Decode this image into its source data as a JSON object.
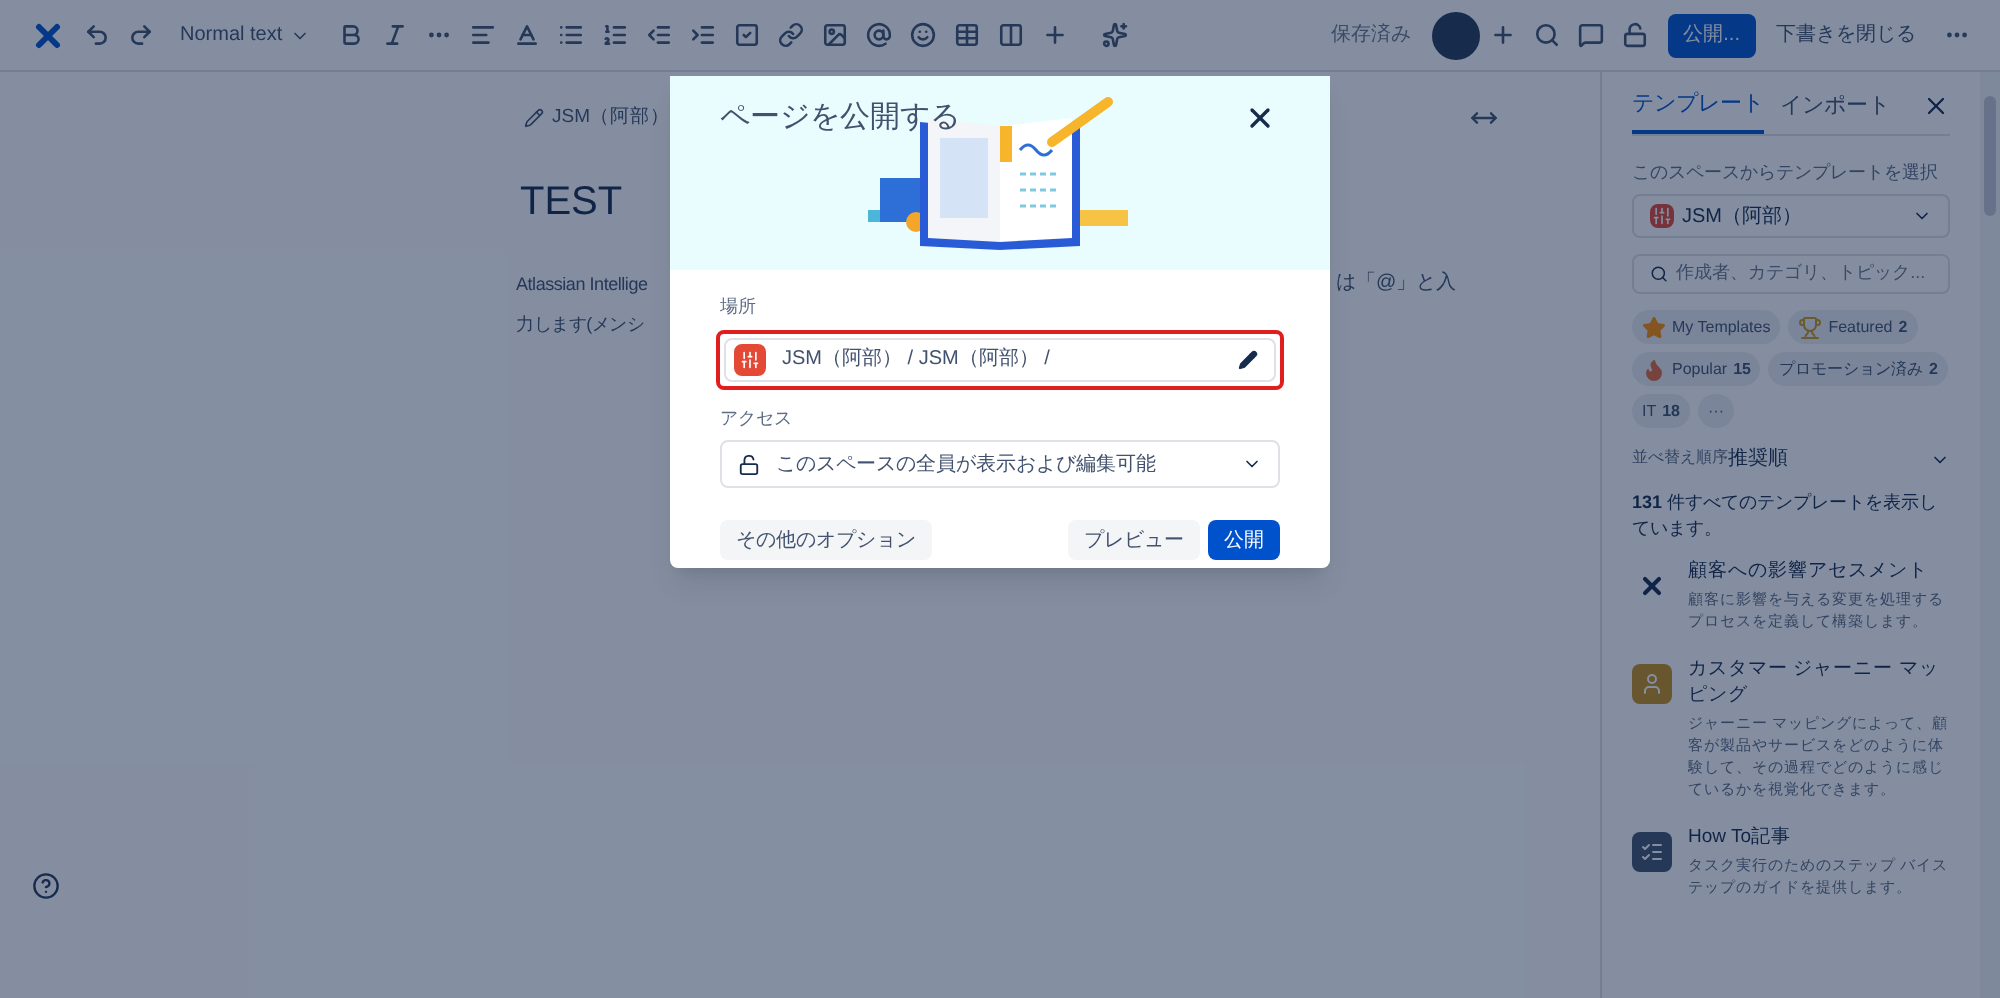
{
  "toolbar": {
    "text_style": "Normal text",
    "save_status": "保存済み",
    "publish_button": "公開...",
    "close_draft": "下書きを閉じる"
  },
  "editor": {
    "breadcrumb": "JSM（阿部）",
    "title": "TEST",
    "body_left_1": "Atlassian Intellige",
    "body_right_1": "は「@」と入",
    "body_left_2": "力します(メンシ"
  },
  "dialog": {
    "title": "ページを公開する",
    "location_label": "場所",
    "location": {
      "value": "JSM（阿部） / JSM（阿部） /",
      "highlighted": true
    },
    "access_label": "アクセス",
    "access": "このスペースの全員が表示および編集可能",
    "buttons": [
      {
        "label": "その他のオプション",
        "kind": "secondary"
      },
      {
        "label": "プレビュー",
        "kind": "secondary"
      },
      {
        "label": "公開",
        "kind": "primary"
      }
    ]
  },
  "sidebar": {
    "tabs": [
      {
        "label": "テンプレート",
        "selected": true
      },
      {
        "label": "インポート",
        "selected": false
      }
    ],
    "space_label": "このスペースからテンプレートを選択",
    "space": "JSM（阿部）",
    "search": {
      "placeholder": "作成者、カテゴリ、トピック..."
    },
    "chips": [
      {
        "kind": "star",
        "label": "My Templates"
      },
      {
        "kind": "trophy",
        "label": "Featured",
        "count": "2"
      },
      {
        "kind": "flame",
        "label": "Popular",
        "count": "15"
      },
      {
        "kind": "plain",
        "label": "プロモーション済み",
        "count": "2"
      },
      {
        "kind": "plain",
        "label": "IT",
        "count": "18"
      },
      {
        "kind": "more",
        "label": "···"
      }
    ],
    "sort_label": "並べ替え順序",
    "sort": "推奨順",
    "summary": "**131** 件すべてのテンプレートを表示しています。",
    "templates": [
      {
        "kind": "logo",
        "title": "顧客への影響アセスメント",
        "description": "顧客に影響を与える変更を処理するプロセスを定義して構築します。"
      },
      {
        "kind": "person",
        "title": "カスタマー ジャーニー マッピング",
        "description": "ジャーニー マッピングによって、顧客が製品やサービスをどのように体験して、その過程でどのように感じているかを視覚化できます。"
      },
      {
        "kind": "list",
        "title": "How To記事",
        "description": "タスク実行のためのステップ バイステップのガイドを提供します。"
      }
    ]
  }
}
